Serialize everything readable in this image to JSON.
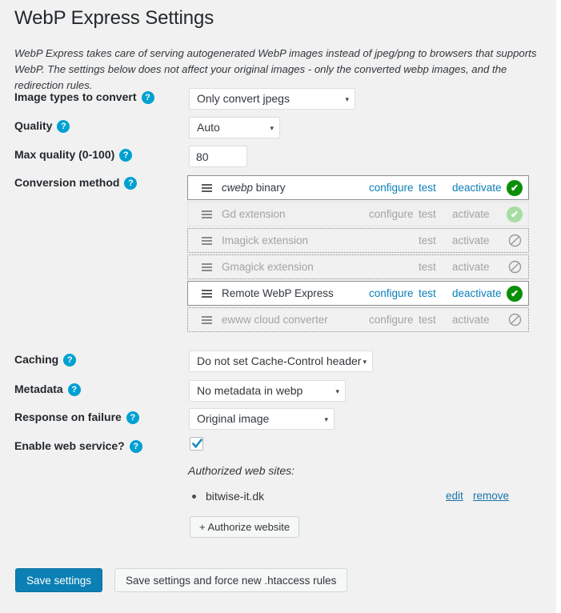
{
  "page": {
    "title": "WebP Express Settings",
    "intro": "WebP Express takes care of serving autogenerated WebP images instead of jpeg/png to browsers that supports WebP. The settings below does not affect your original images - only the converted webp images, and the redirection rules.",
    "help_glyph": "?",
    "accent_blue": "#0c80b4",
    "link_blue": "#0b80b8",
    "help_icon_blue": "#00a0d2",
    "status_green": "#0a8f08",
    "status_green_faded": "#a7dda4",
    "status_gray": "#9a9a9a"
  },
  "fields": {
    "image_types": {
      "label": "Image types to convert",
      "value": "Only convert jpegs",
      "caret": "▾"
    },
    "quality": {
      "label": "Quality",
      "value": "Auto",
      "caret": "▾"
    },
    "max_quality": {
      "label": "Max quality (0-100)",
      "value": "80",
      "placeholder": ""
    },
    "conversion_method": {
      "label": "Conversion method"
    },
    "caching": {
      "label": "Caching",
      "value": "Do not set Cache-Control header",
      "caret": "▾"
    },
    "metadata": {
      "label": "Metadata",
      "value": "No metadata in webp",
      "caret": "▾"
    },
    "response_on_failure": {
      "label": "Response on failure",
      "value": "Original image",
      "caret": "▾"
    },
    "enable_web_service": {
      "label": "Enable web service?",
      "checked": true
    }
  },
  "conversion_methods": [
    {
      "name_italic": "cwebp",
      "name_rest": " binary",
      "state": "active",
      "configure": "configure",
      "test": "test",
      "toggle": "deactivate",
      "status": "ok-strong",
      "status_glyph": "✔",
      "has_configure": true
    },
    {
      "name_italic": "",
      "name_rest": "Gd extension",
      "state": "available",
      "configure": "configure",
      "test": "test",
      "toggle": "activate",
      "status": "ok-weak",
      "status_glyph": "✔",
      "has_configure": true
    },
    {
      "name_italic": "",
      "name_rest": "Imagick extension",
      "state": "unavailable",
      "configure": "",
      "test": "test",
      "toggle": "activate",
      "status": "blocked",
      "status_glyph": "⃠",
      "has_configure": false
    },
    {
      "name_italic": "",
      "name_rest": "Gmagick extension",
      "state": "unavailable",
      "configure": "",
      "test": "test",
      "toggle": "activate",
      "status": "blocked",
      "status_glyph": "⃠",
      "has_configure": false
    },
    {
      "name_italic": "",
      "name_rest": "Remote WebP Express",
      "state": "active",
      "configure": "configure",
      "test": "test",
      "toggle": "deactivate",
      "status": "ok-strong",
      "status_glyph": "✔",
      "has_configure": true
    },
    {
      "name_italic": "",
      "name_rest": "ewww cloud converter",
      "state": "unavailable",
      "configure": "configure",
      "test": "test",
      "toggle": "activate",
      "status": "blocked",
      "status_glyph": "⃠",
      "has_configure": true
    }
  ],
  "authorized_sites": {
    "title": "Authorized web sites:",
    "items": [
      {
        "name": "bitwise-it.dk",
        "edit": "edit",
        "remove": "remove"
      }
    ],
    "add_button": "+ Authorize website"
  },
  "footer": {
    "save": "Save settings",
    "save_force": "Save settings and force new .htaccess rules"
  }
}
